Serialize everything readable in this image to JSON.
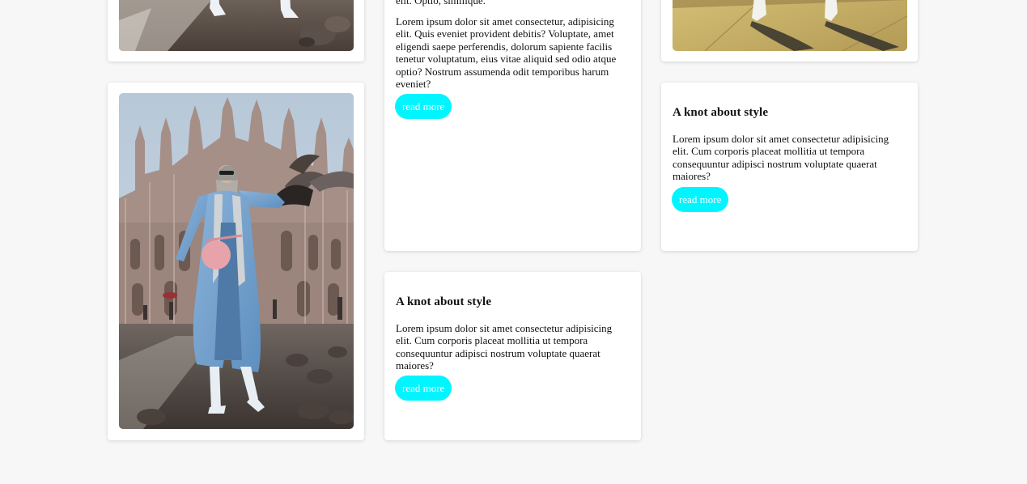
{
  "columns": {
    "left": {
      "top_card": {
        "image_alt": "Person in white boots on a stone pavement"
      },
      "bottom_card": {
        "image_alt": "Woman in a blue coat with pigeons in front of a gothic cathedral"
      }
    },
    "middle": {
      "top_card": {
        "cut_text": "elit. Optio, similique.",
        "body": "Lorem ipsum dolor sit amet consectetur, adipisicing elit. Quis eveniet provident debitis? Voluptate, amet eligendi saepe perferendis, dolorum sapiente facilis tenetur voluptatum, eius vitae aliquid sed odio atque optio? Nostrum assumenda odit temporibus harum eveniet?",
        "button": "read more"
      },
      "bottom_card": {
        "title": "A knot about style",
        "body": "Lorem ipsum dolor sit amet consectetur adipisicing elit. Cum corporis placeat mollitia ut tempora consequuntur adipisci nostrum voluptate quaerat maiores?",
        "button": "read more"
      }
    },
    "right": {
      "top_card": {
        "image_alt": "White boots on a sunlit street with shadows"
      },
      "bottom_card": {
        "title": "A knot about style",
        "body": "Lorem ipsum dolor sit amet consectetur adipisicing elit. Cum corporis placeat mollitia ut tempora consequuntur adipisci nostrum voluptate quaerat maiores?",
        "button": "read more"
      }
    }
  },
  "colors": {
    "background": "#f7f7f7",
    "card": "#ffffff",
    "button": "#00f5ff",
    "button_text": "#ffffff"
  }
}
